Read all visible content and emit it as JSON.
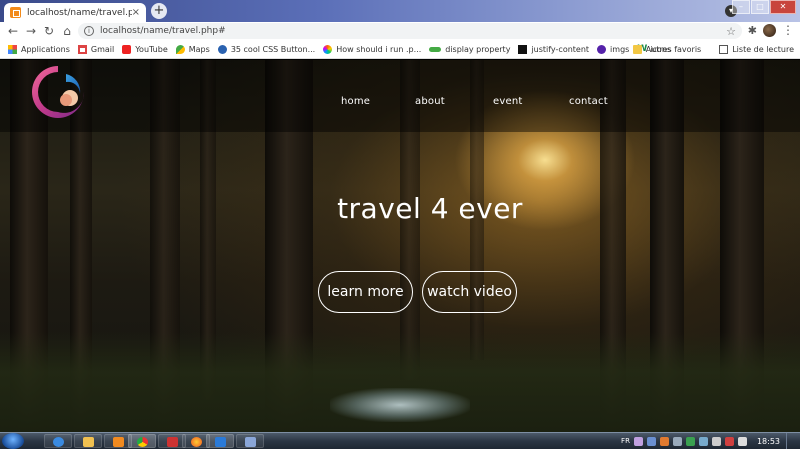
{
  "browser": {
    "tab": {
      "title": "localhost/name/travel.php#",
      "close": "×"
    },
    "new_tab": "+",
    "address": {
      "url": "localhost/name/travel.php#"
    },
    "nav": {
      "back": "←",
      "forward": "→",
      "reload": "↻",
      "home": "⌂"
    },
    "star": "☆",
    "menu": "⋮",
    "extensions": "✱"
  },
  "bookmarks": {
    "items": [
      {
        "label": "Applications",
        "icon": "apps-grid-icon"
      },
      {
        "label": "Gmail",
        "icon": "gmail-icon"
      },
      {
        "label": "YouTube",
        "icon": "youtube-icon"
      },
      {
        "label": "Maps",
        "icon": "maps-icon"
      },
      {
        "label": "35 cool CSS Button...",
        "icon": "w3-icon"
      },
      {
        "label": "How should i run .p...",
        "icon": "swirl-icon"
      },
      {
        "label": "display property",
        "icon": "display-property-icon"
      },
      {
        "label": "justify-content",
        "icon": "justify-content-icon"
      },
      {
        "label": "imgs",
        "icon": "imgs-icon"
      },
      {
        "label": "icons",
        "icon": "icons-w-icon"
      }
    ],
    "right": [
      {
        "label": "Autres favoris",
        "icon": "folder-icon"
      },
      {
        "label": "Liste de lecture",
        "icon": "reading-list-icon"
      }
    ]
  },
  "site": {
    "nav": [
      "home",
      "about",
      "event",
      "contact"
    ],
    "hero_title": "travel 4 ever",
    "cta_primary": "learn more",
    "cta_secondary": "watch video",
    "logo": "circular-swirl-logo"
  },
  "taskbar": {
    "language": "FR",
    "time": "18:53",
    "colors": {
      "bar": "#2b3644",
      "start": "#1a4e9a"
    }
  }
}
